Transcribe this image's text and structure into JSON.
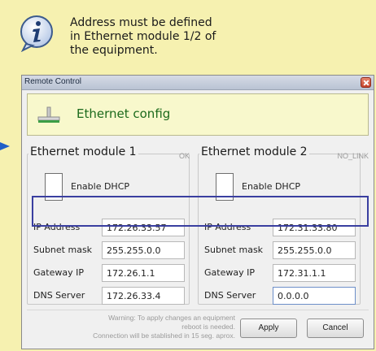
{
  "tooltip": {
    "line1": "Address must be defined",
    "line2": "in Ethernet module 1/2 of",
    "line3": "the equipment.",
    "icon": "info-icon"
  },
  "window": {
    "title": "Remote Control",
    "close_icon": "close-icon"
  },
  "header": {
    "title": "Ethernet config",
    "icon": "ethernet-icon"
  },
  "modules": [
    {
      "title": "Ethernet module 1",
      "status": "OK",
      "dhcp_label": "Enable DHCP",
      "fields": {
        "ip_label": "IP Address",
        "ip_value": "172.26.33.57",
        "mask_label": "Subnet mask",
        "mask_value": "255.255.0.0",
        "gw_label": "Gateway IP",
        "gw_value": "172.26.1.1",
        "dns_label": "DNS Server",
        "dns_value": "172.26.33.4"
      }
    },
    {
      "title": "Ethernet module 2",
      "status": "NO_LINK",
      "dhcp_label": "Enable DHCP",
      "fields": {
        "ip_label": "IP Address",
        "ip_value": "172.31.33.80",
        "mask_label": "Subnet mask",
        "mask_value": "255.255.0.0",
        "gw_label": "Gateway IP",
        "gw_value": "172.31.1.1",
        "dns_label": "DNS Server",
        "dns_value": "0.0.0.0"
      }
    }
  ],
  "footer": {
    "warning_line1": "Warning: To apply changes an equipment",
    "warning_line2": "reboot is needed.",
    "warning_line3": "Connection will be stablished in 15 seg. aprox.",
    "apply_label": "Apply",
    "cancel_label": "Cancel"
  },
  "colors": {
    "background": "#f6f1b0",
    "header_text": "#1c6a1c",
    "highlight": "#3a3fa0",
    "arrow": "#1f5fc8"
  }
}
